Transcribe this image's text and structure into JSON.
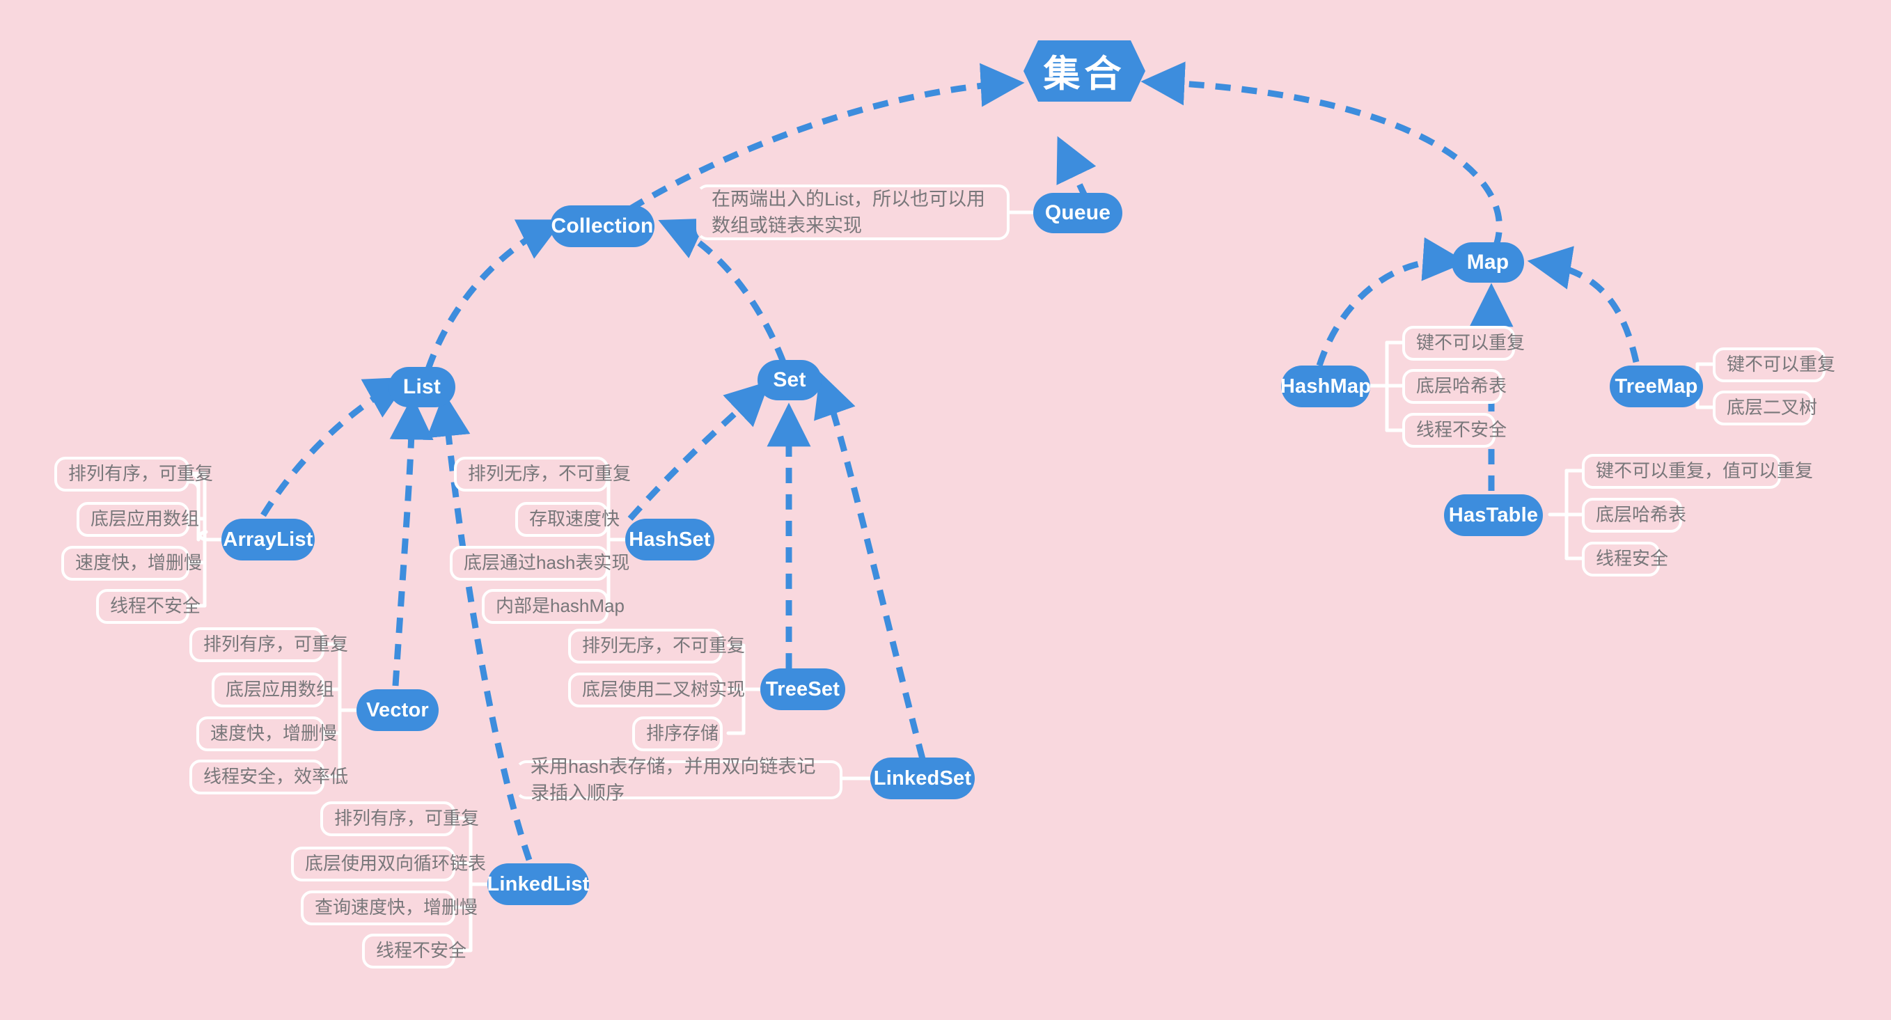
{
  "diagram": {
    "title": "集合",
    "background_color": "#f9d8de",
    "node_color": "#3d8ddd",
    "node_text_color": "#ffffff",
    "chip_text_color": "#78777a",
    "chip_border_color": "#ffffff"
  },
  "nodes": {
    "root": "集合",
    "collection": "Collection",
    "queue": "Queue",
    "map": "Map",
    "list": "List",
    "set": "Set",
    "arraylist": "ArrayList",
    "vector": "Vector",
    "linkedlist": "LinkedList",
    "hashset": "HashSet",
    "treeset": "TreeSet",
    "linkedset": "LinkedSet",
    "hashmap": "HashMap",
    "hastable": "HasTable",
    "treemap": "TreeMap"
  },
  "notes": {
    "queue_note": "在两端出入的List，所以也可以用数组或链表来实现",
    "linkedset_note": "采用hash表存储，并用双向链表记录插入顺序"
  },
  "attributes": {
    "arraylist": [
      "排列有序，可重复",
      "底层应用数组",
      "速度快，增删慢",
      "线程不安全"
    ],
    "vector": [
      "排列有序，可重复",
      "底层应用数组",
      "速度快，增删慢",
      "线程安全，效率低"
    ],
    "linkedlist": [
      "排列有序，可重复",
      "底层使用双向循环链表",
      "查询速度快，增删慢",
      "线程不安全"
    ],
    "hashset": [
      "排列无序，不可重复",
      "存取速度快",
      "底层通过hash表实现",
      "内部是hashMap"
    ],
    "treeset": [
      "排列无序，不可重复",
      "底层使用二叉树实现",
      "排序存储"
    ],
    "hashmap": [
      "键不可以重复",
      "底层哈希表",
      "线程不安全"
    ],
    "hastable": [
      "键不可以重复，值可以重复",
      "底层哈希表",
      "线程安全"
    ],
    "treemap": [
      "键不可以重复",
      "底层二叉树"
    ]
  }
}
